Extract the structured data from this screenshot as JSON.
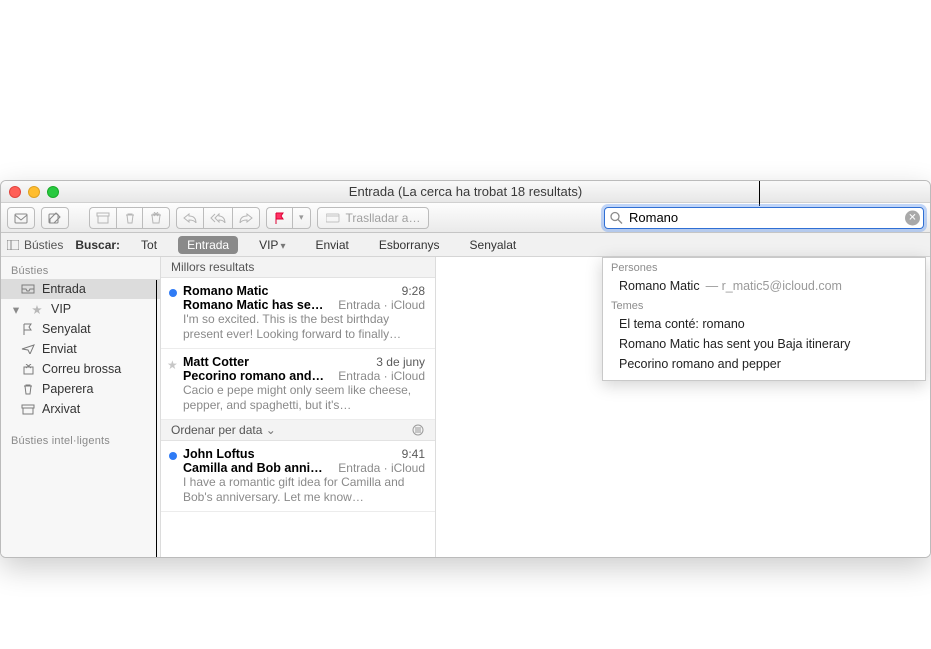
{
  "window_title": "Entrada (La cerca ha trobat 18 resultats)",
  "toolbar": {
    "move_placeholder": "Traslladar a…"
  },
  "search": {
    "value": "Romano"
  },
  "scopebar": {
    "toggle_label": "Bústies",
    "search_label": "Buscar:",
    "scopes": [
      "Tot",
      "Entrada",
      "VIP",
      "Enviat",
      "Esborranys",
      "Senyalat"
    ],
    "active_index": 1,
    "dropdown_index": 2
  },
  "sidebar": {
    "header1": "Bústies",
    "items": [
      {
        "label": "Entrada",
        "selected": true,
        "icon": "inbox"
      },
      {
        "label": "VIP",
        "disclose": true,
        "icon": "star"
      },
      {
        "label": "Senyalat",
        "indent": true,
        "icon": "flag"
      },
      {
        "label": "Enviat",
        "indent": true,
        "icon": "sent"
      },
      {
        "label": "Correu brossa",
        "indent": true,
        "icon": "junk"
      },
      {
        "label": "Paperera",
        "indent": true,
        "icon": "trash"
      },
      {
        "label": "Arxivat",
        "indent": true,
        "icon": "archive"
      }
    ],
    "header2": "Bústies intel·ligents"
  },
  "msglist": {
    "top_header": "Millors resultats",
    "sort_label": "Ordenar per data",
    "groups": [
      {
        "kind": "top",
        "messages": [
          {
            "unread": true,
            "sender": "Romano Matic",
            "time": "9:28",
            "subject": "Romano Matic has se…",
            "folder": "Entrada · iCloud",
            "preview": "I'm so excited. This is the best birthday present ever! Looking forward to finally…"
          },
          {
            "star": true,
            "sender": "Matt Cotter",
            "time": "3 de juny",
            "subject": "Pecorino romano and…",
            "folder": "Entrada · iCloud",
            "preview": "Cacio e pepe might only seem like cheese, pepper, and spaghetti, but it's…"
          }
        ]
      },
      {
        "kind": "rest",
        "messages": [
          {
            "unread": true,
            "sender": "John Loftus",
            "time": "9:41",
            "subject": "Camilla and Bob anni…",
            "folder": "Entrada · iCloud",
            "preview": "I have a romantic gift idea for Camilla and Bob's anniversary. Let me know…"
          }
        ]
      }
    ]
  },
  "suggestions": {
    "people_header": "Persones",
    "people": [
      {
        "name": "Romano Matic",
        "email": "r_matic5@icloud.com"
      }
    ],
    "topics_header": "Temes",
    "topics": [
      "El tema conté: romano",
      "Romano Matic has sent you Baja itinerary",
      "Pecorino romano and pepper"
    ]
  }
}
